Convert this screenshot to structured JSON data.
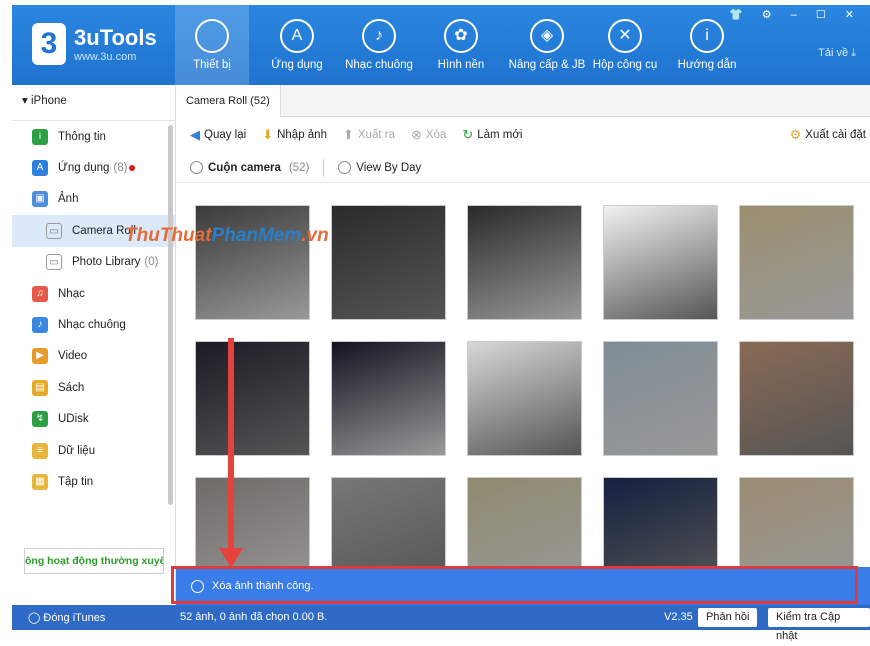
{
  "app": {
    "brand": "3uTools",
    "url": "www.3u.com",
    "logo_char": "3"
  },
  "nav": [
    {
      "label": "Thiết bị",
      "icon": "apple-icon",
      "glyph": ""
    },
    {
      "label": "Ứng dụng",
      "icon": "appstore-icon",
      "glyph": "A"
    },
    {
      "label": "Nhạc chuông",
      "icon": "bell-icon",
      "glyph": "♪"
    },
    {
      "label": "Hình nền",
      "icon": "flower-icon",
      "glyph": "✿"
    },
    {
      "label": "Nâng cấp & JB",
      "icon": "dropbox-icon",
      "glyph": "◈"
    },
    {
      "label": "Hộp công cụ",
      "icon": "tools-icon",
      "glyph": "✕"
    },
    {
      "label": "Hướng dẫn",
      "icon": "info-icon",
      "glyph": "i"
    }
  ],
  "window_controls": "👕 ⚙ – ☐ ✕",
  "taive": "Tải về ⤓",
  "sidebar": {
    "device": "iPhone",
    "items": [
      {
        "label": "Thông tin",
        "count": "",
        "color": "#2ea043",
        "glyph": "i"
      },
      {
        "label": "Ứng dụng",
        "count": "(8)",
        "color": "#2f7fe0",
        "glyph": "A"
      },
      {
        "label": "Ảnh",
        "count": "",
        "color": "#4a8fd8",
        "glyph": "▣"
      },
      {
        "label": "Camera Roll",
        "count": "",
        "color": "#999",
        "glyph": "▭"
      },
      {
        "label": "Photo Library",
        "count": "(0)",
        "color": "#999",
        "glyph": "▭"
      },
      {
        "label": "Nhạc",
        "count": "",
        "color": "#e55a4a",
        "glyph": "♫"
      },
      {
        "label": "Nhạc chuông",
        "count": "",
        "color": "#3a88e0",
        "glyph": "♪"
      },
      {
        "label": "Video",
        "count": "",
        "color": "#e89b2b",
        "glyph": "▶"
      },
      {
        "label": "Sách",
        "count": "",
        "color": "#e8a92b",
        "glyph": "▤"
      },
      {
        "label": "UDisk",
        "count": "",
        "color": "#2ea043",
        "glyph": "↯"
      },
      {
        "label": "Dữ liệu",
        "count": "",
        "color": "#e8b63b",
        "glyph": "≡"
      },
      {
        "label": "Tập tin",
        "count": "",
        "color": "#e8b63b",
        "glyph": "▦"
      }
    ],
    "banner": "ông hoạt động thường xuyê"
  },
  "tab": "Camera Roll (52)",
  "toolbar": {
    "back": "Quay lại",
    "import": "Nhập ảnh",
    "export": "Xuất ra",
    "delete": "Xóa",
    "refresh": "Làm mới",
    "settings": "Xuất cài đặt"
  },
  "filter": {
    "camera": "Cuộn camera",
    "camera_count": "(52)",
    "by_day": "View By Day"
  },
  "watermark": {
    "a": "ThuThuat",
    "b": "PhanMem",
    ".vn": ".vn"
  },
  "toast": "Xóa ảnh thành công.",
  "status": {
    "itunes": "Đóng iTunes",
    "summary": "52 ảnh, 0 ảnh đã chọn 0.00 B.",
    "version": "V2.35",
    "feedback": "Phản hồi",
    "update": "Kiểm tra Cập nhật"
  },
  "photos_colors": [
    "#3a3a3a",
    "#2b2b2b",
    "#2a2a2a",
    "#f2f2f2",
    "#9a8f6e",
    "#1c1a24",
    "#141220",
    "#d8d8d8",
    "#7f8c95",
    "#8a6a55",
    "#6e6a66",
    "#777",
    "#8f8a6e",
    "#142040",
    "#9a8c72"
  ]
}
